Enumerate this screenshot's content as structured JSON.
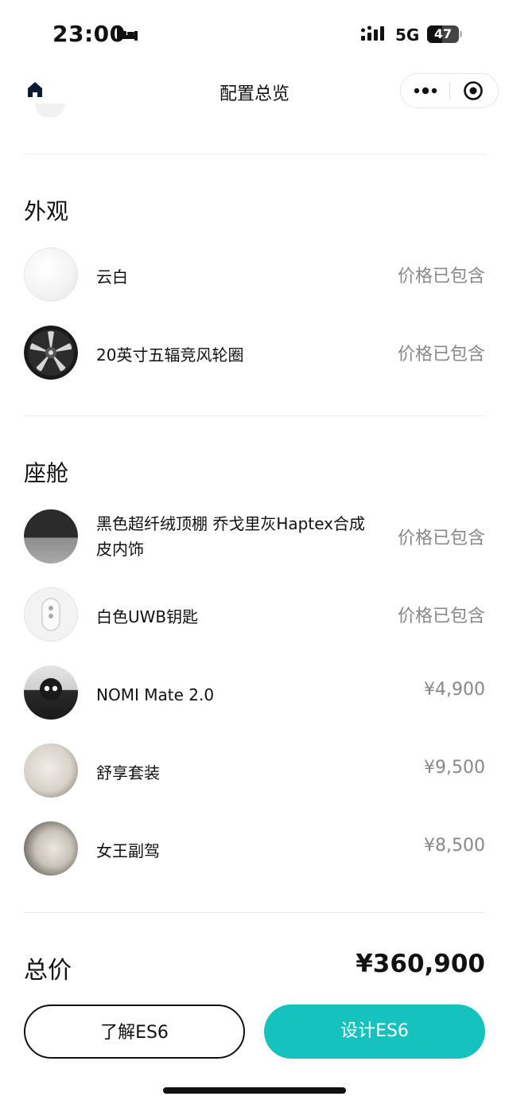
{
  "status": {
    "time": "23:00",
    "network": "5G",
    "battery": "47",
    "battery_level": 0.47
  },
  "nav": {
    "title": "配置总览"
  },
  "sections": [
    {
      "title": "外观",
      "items": [
        {
          "label": "云白",
          "price": "价格已包含",
          "icon": "cloud-white-paint-swatch"
        },
        {
          "label": "20英寸五辐竞风轮圈",
          "price": "价格已包含",
          "icon": "wheel-rim"
        }
      ]
    },
    {
      "title": "座舱",
      "items": [
        {
          "label": "黑色超纤绒顶棚 乔戈里灰Haptex合成皮内饰",
          "price": "价格已包含",
          "icon": "interior-color-swatch"
        },
        {
          "label": "白色UWB钥匙",
          "price": "价格已包含",
          "icon": "uwb-key"
        },
        {
          "label": "NOMI Mate 2.0",
          "price": "¥4,900",
          "icon": "nomi-mate"
        },
        {
          "label": "舒享套装",
          "price": "¥9,500",
          "icon": "comfort-seat"
        },
        {
          "label": "女王副驾",
          "price": "¥8,500",
          "icon": "queen-passenger-seat"
        }
      ]
    }
  ],
  "total": {
    "label": "总价",
    "value": "¥360,900"
  },
  "buttons": {
    "learn": "了解ES6",
    "design": "设计ES6"
  },
  "colors": {
    "accent": "#16c2bd",
    "price_text": "#888888"
  }
}
